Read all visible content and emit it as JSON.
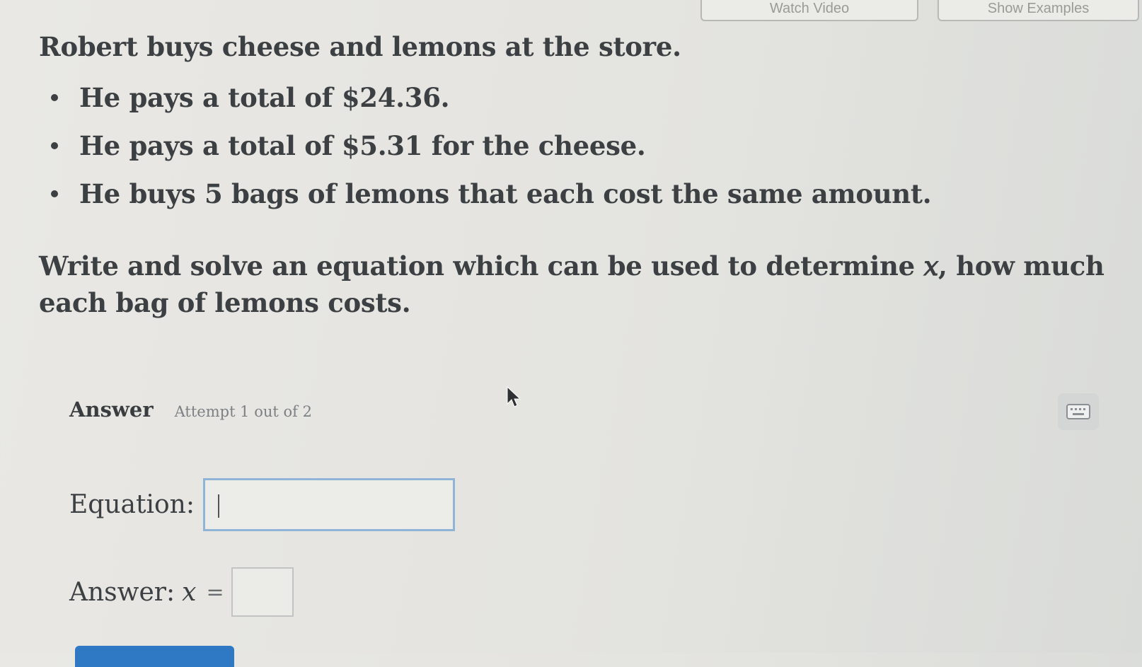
{
  "top_buttons": {
    "watch_video_label": "Watch Video",
    "show_examples_label": "Show Examples"
  },
  "question": {
    "intro": "Robert buys cheese and lemons at the store.",
    "bullets": [
      "He pays a total of $24.36.",
      "He pays a total of $5.31 for the cheese.",
      "He buys 5 bags of lemons that each cost the same amount."
    ],
    "prompt": "Write and solve an equation which can be used to determine 𝑥, how much each bag of lemons costs."
  },
  "answer_section": {
    "title": "Answer",
    "attempt": "Attempt 1 out of 2",
    "keyboard_icon": "keyboard-icon",
    "equation_label": "Equation:",
    "equation_value": "",
    "answer_label": "Answer:",
    "variable": "x",
    "equals": "=",
    "answer_value": ""
  },
  "colors": {
    "input_focus_border": "#8fb4d6",
    "submit_button": "#2f78c4",
    "text": "#3d4043"
  }
}
